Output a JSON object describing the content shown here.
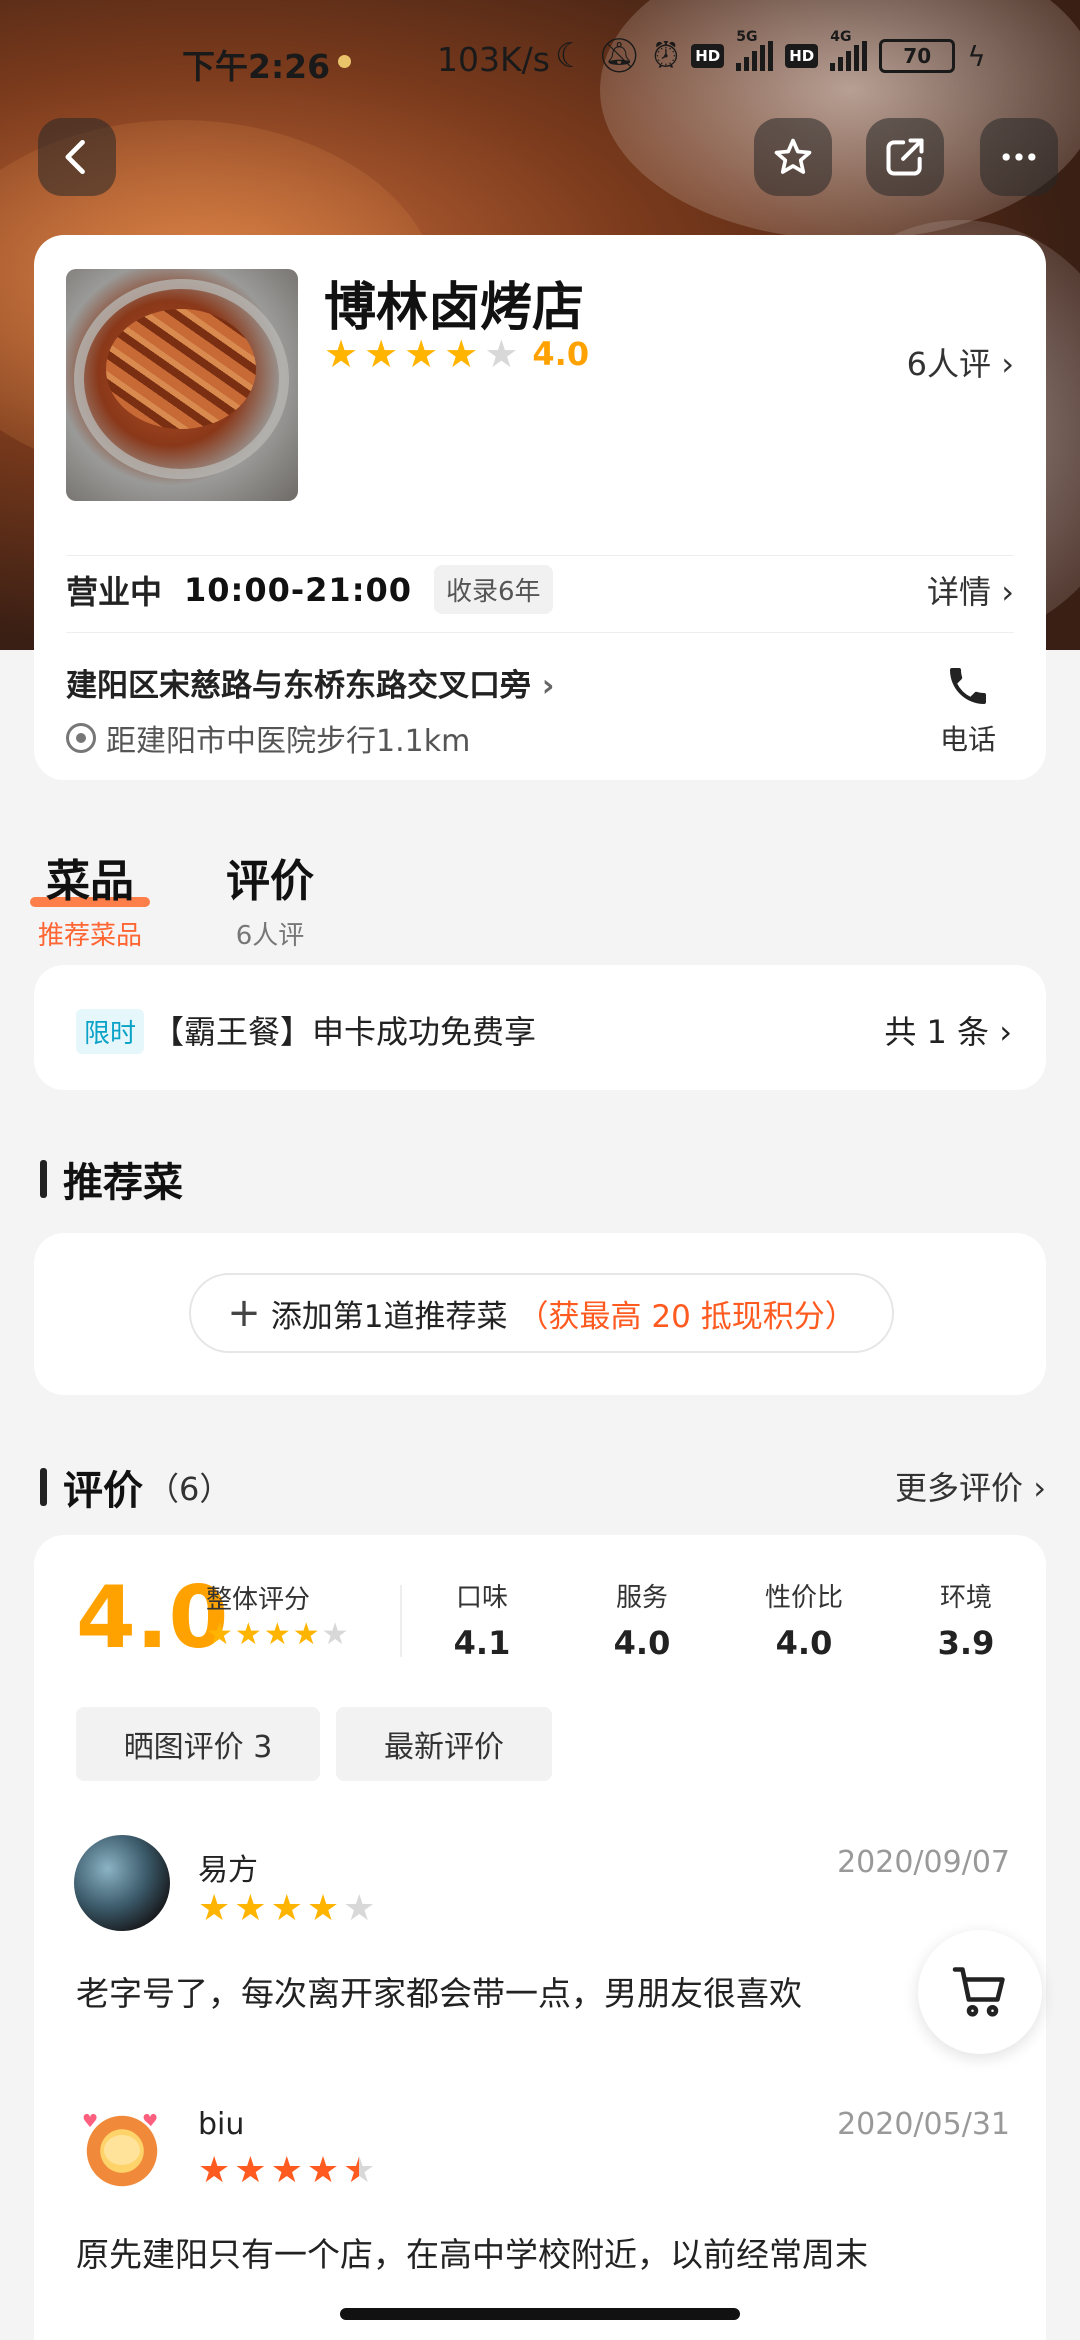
{
  "status_bar": {
    "time": "下午2:26",
    "net_speed": "103K/s",
    "network1": "5G",
    "network2": "4G",
    "battery": "70"
  },
  "shop": {
    "name": "博林卤烤店",
    "rating": "4.0",
    "rating_stars": 4,
    "review_count": "6人评",
    "status": "营业中",
    "hours": "10:00-21:00",
    "listed_tag": "收录6年",
    "details_label": "详情",
    "address": "建阳区宋慈路与东桥东路交叉口旁",
    "distance": "距建阳市中医院步行1.1km",
    "phone_label": "电话"
  },
  "tabs": [
    {
      "label": "菜品",
      "sub": "推荐菜品",
      "active": true
    },
    {
      "label": "评价",
      "sub": "6人评",
      "active": false
    }
  ],
  "promo": {
    "tag": "限时",
    "text": "【霸王餐】申卡成功免费享",
    "count": "共 1 条"
  },
  "recommend": {
    "title": "推荐菜",
    "add_label": "添加第1道推荐菜",
    "bonus": "（获最高 20 抵现积分）"
  },
  "reviews": {
    "title": "评价",
    "count": "（6）",
    "more_label": "更多评价",
    "overall_score": "4.0",
    "overall_label": "整体评分",
    "sub_scores": [
      {
        "label": "口味",
        "value": "4.1"
      },
      {
        "label": "服务",
        "value": "4.0"
      },
      {
        "label": "性价比",
        "value": "4.0"
      },
      {
        "label": "环境",
        "value": "3.9"
      }
    ],
    "filters": [
      "晒图评价 3",
      "最新评价"
    ],
    "items": [
      {
        "user": "易方",
        "date": "2020/09/07",
        "stars": 4,
        "text": "老字号了，每次离开家都会带一点，男朋友很喜欢"
      },
      {
        "user": "biu",
        "date": "2020/05/31",
        "stars": 4.5,
        "text": "原先建阳只有一个店，在高中学校附近，以前经常周末"
      }
    ]
  },
  "colors": {
    "accent_orange": "#ff5a1f",
    "star_yellow": "#ffb400",
    "score_orange": "#ffa200",
    "promo_tag_blue": "#0aa2c7"
  },
  "icons": [
    "back-icon",
    "star-outline-icon",
    "share-icon",
    "more-icon",
    "phone-icon",
    "location-icon",
    "plus-icon",
    "cart-icon",
    "chevron-right-icon"
  ]
}
